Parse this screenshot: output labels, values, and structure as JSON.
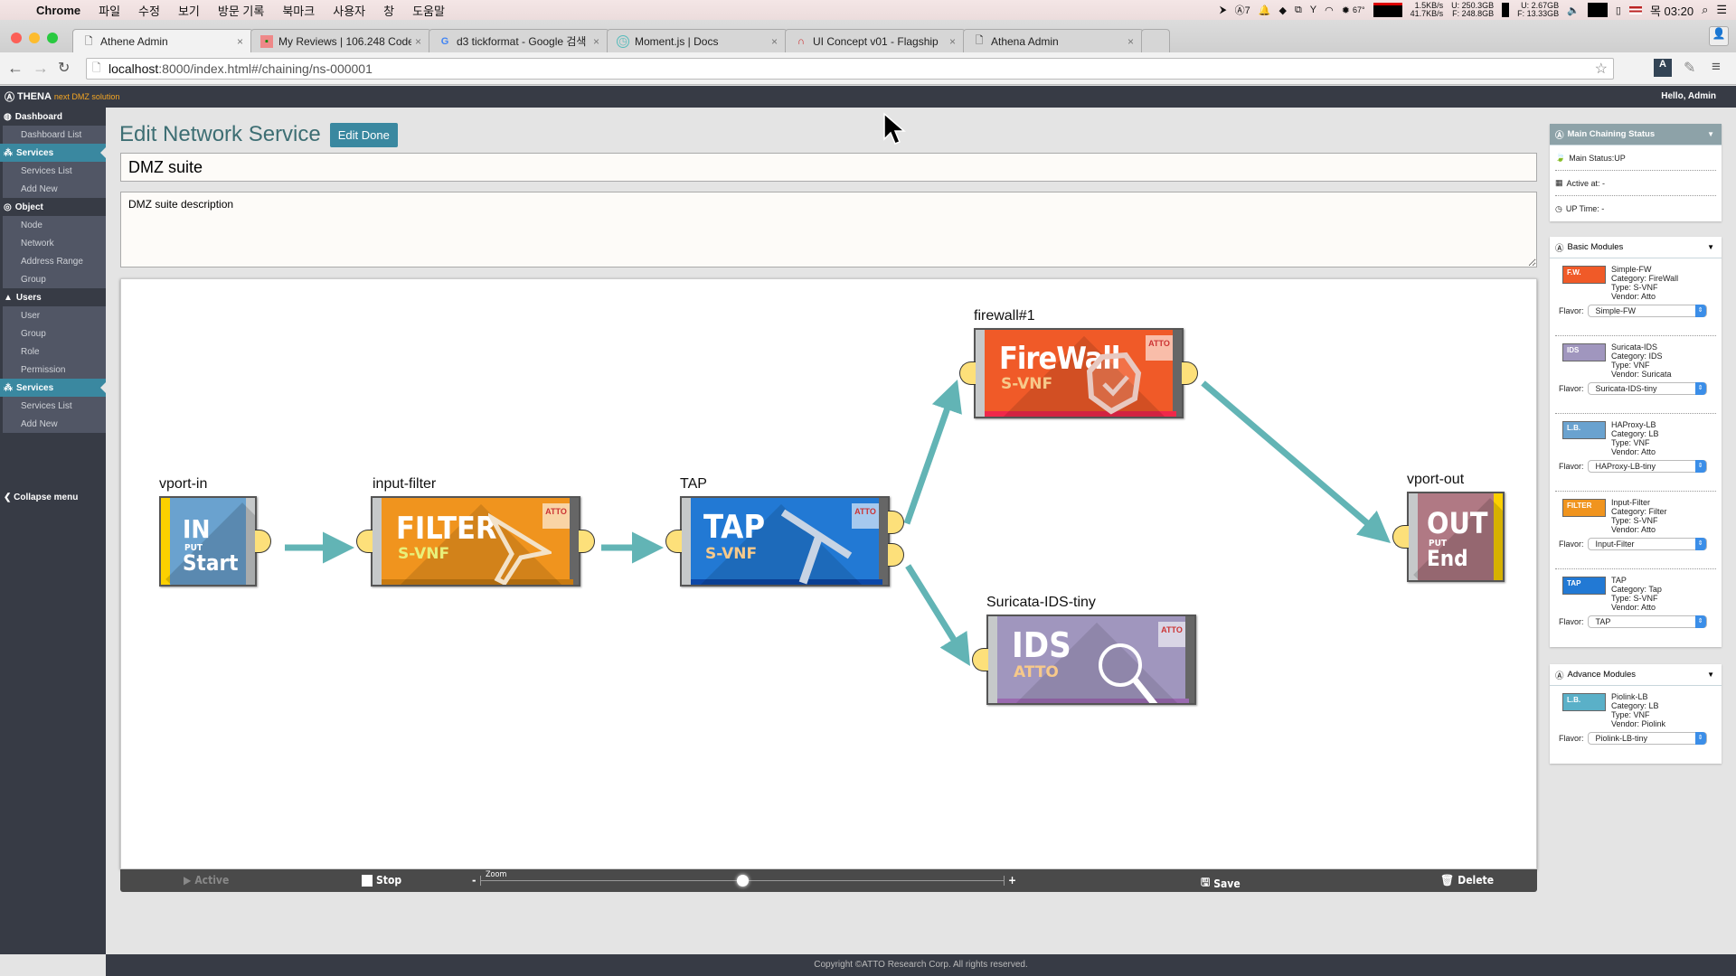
{
  "menubar": {
    "app": "Chrome",
    "items": [
      "파일",
      "수정",
      "보기",
      "방문 기록",
      "북마크",
      "사용자",
      "창",
      "도움말"
    ],
    "status": {
      "temperature": "67°",
      "net_up": "1.5KB/s",
      "net_down": "41.7KB/s",
      "disk_used": "U: 250.3GB",
      "disk_free": "F: 248.8GB",
      "mem_used": "U:  2.67GB",
      "mem_free": "F: 13.33GB",
      "clock": "목 03:20",
      "notif_count": "7"
    }
  },
  "browser": {
    "tabs": [
      {
        "title": "Athene Admin",
        "icon": "page-icon",
        "active": true
      },
      {
        "title": "My Reviews | 106.248 Code",
        "icon": "review-icon",
        "active": false
      },
      {
        "title": "d3 tickformat - Google 검색",
        "icon": "google-icon",
        "active": false
      },
      {
        "title": "Moment.js | Docs",
        "icon": "clock-icon",
        "active": false
      },
      {
        "title": "UI Concept v01 - Flagship",
        "icon": "flagship-icon",
        "active": false
      },
      {
        "title": "Athena Admin",
        "icon": "page-icon",
        "active": false
      }
    ],
    "url_host": "localhost",
    "url_rest": ":8000/index.html#/chaining/ns-000001"
  },
  "app": {
    "logo": "THENA",
    "logo_sub": "next DMZ solution",
    "greeting": "Hello, Admin",
    "footer": "Copyright ©ATTO Research Corp. All rights reserved."
  },
  "sidebar": {
    "groups": [
      {
        "label": "Dashboard",
        "icon": "dashboard-icon",
        "active": false,
        "items": [
          "Dashboard List"
        ]
      },
      {
        "label": "Services",
        "icon": "services-icon",
        "active": true,
        "items": [
          "Services List",
          "Add New"
        ]
      },
      {
        "label": "Object",
        "icon": "object-icon",
        "active": false,
        "items": [
          "Node",
          "Network",
          "Address Range",
          "Group"
        ]
      },
      {
        "label": "Users",
        "icon": "user-icon",
        "active": false,
        "items": [
          "User",
          "Group",
          "Role",
          "Permission"
        ]
      },
      {
        "label": "Services",
        "icon": "services-icon",
        "active": true,
        "items": [
          "Services List",
          "Add New"
        ]
      }
    ],
    "collapse": "Collapse menu"
  },
  "editor": {
    "title": "Edit Network Service",
    "edit_done": "Edit Done",
    "name": "DMZ suite",
    "description": "DMZ suite description"
  },
  "chain": {
    "nodes": [
      {
        "id": "vport-in",
        "label": "vport-in",
        "big": "IN",
        "mid": "PUT",
        "small": "Start",
        "color": "#6aa2cf"
      },
      {
        "id": "input-filter",
        "label": "input-filter",
        "big": "FILTER",
        "small": "S-VNF",
        "color": "#f0941e"
      },
      {
        "id": "tap",
        "label": "TAP",
        "big": "TAP",
        "small": "S-VNF",
        "color": "#2279d4"
      },
      {
        "id": "firewall",
        "label": "firewall#1",
        "big": "FireWall",
        "small": "S-VNF",
        "color": "#f05a28"
      },
      {
        "id": "ids",
        "label": "Suricata-IDS-tiny",
        "big": "IDS",
        "small": "ATTO",
        "color": "#a096be"
      },
      {
        "id": "vport-out",
        "label": "vport-out",
        "big": "OUT",
        "mid": "PUT",
        "small": "End",
        "color": "#b07984"
      }
    ],
    "links": [
      [
        "vport-in",
        "input-filter"
      ],
      [
        "input-filter",
        "tap"
      ],
      [
        "tap",
        "firewall"
      ],
      [
        "tap",
        "ids"
      ],
      [
        "firewall",
        "vport-out"
      ]
    ],
    "brand_badge": "ATTO"
  },
  "controls": {
    "active": "Active",
    "stop": "Stop",
    "zoom_label": "Zoom",
    "zoom_minus": "-",
    "zoom_plus": "+",
    "zoom_level": 0.5,
    "save": "Save",
    "delete": "Delete"
  },
  "status_panel": {
    "title": "Main Chaining Status",
    "rows": [
      {
        "icon": "leaf-icon",
        "text": "Main Status:UP"
      },
      {
        "icon": "calendar-icon",
        "text": "Active at: -"
      },
      {
        "icon": "clock-icon",
        "text": "UP Time: -"
      }
    ]
  },
  "basic_modules": {
    "title": "Basic Modules",
    "items": [
      {
        "name": "Simple-FW",
        "category": "Category: FireWall",
        "type": "Type: S-VNF",
        "vendor": "Vendor: Atto",
        "flavor": "Simple-FW",
        "color": "#f05a28",
        "tag": "F.W."
      },
      {
        "name": "Suricata-IDS",
        "category": "Category: IDS",
        "type": "Type: VNF",
        "vendor": "Vendor: Suricata",
        "flavor": "Suricata-IDS-tiny",
        "color": "#a096be",
        "tag": "IDS"
      },
      {
        "name": "HAProxy-LB",
        "category": "Category: LB",
        "type": "Type: VNF",
        "vendor": "Vendor: Atto",
        "flavor": "HAProxy-LB-tiny",
        "color": "#6aa2cf",
        "tag": "L.B."
      },
      {
        "name": "Input-Filter",
        "category": "Category: Filter",
        "type": "Type: S-VNF",
        "vendor": "Vendor: Atto",
        "flavor": "Input-Filter",
        "color": "#f0941e",
        "tag": "FILTER"
      },
      {
        "name": "TAP",
        "category": "Category: Tap",
        "type": "Type: S-VNF",
        "vendor": "Vendor: Atto",
        "flavor": "TAP",
        "color": "#2279d4",
        "tag": "TAP"
      }
    ],
    "flavor_label": "Flavor:"
  },
  "advance_modules": {
    "title": "Advance Modules",
    "items": [
      {
        "name": "Piolink-LB",
        "category": "Category: LB",
        "type": "Type: VNF",
        "vendor": "Vendor: Piolink",
        "flavor": "Piolink-LB-tiny",
        "color": "#5ab0c8",
        "tag": "L.B."
      }
    ],
    "flavor_label": "Flavor:"
  }
}
